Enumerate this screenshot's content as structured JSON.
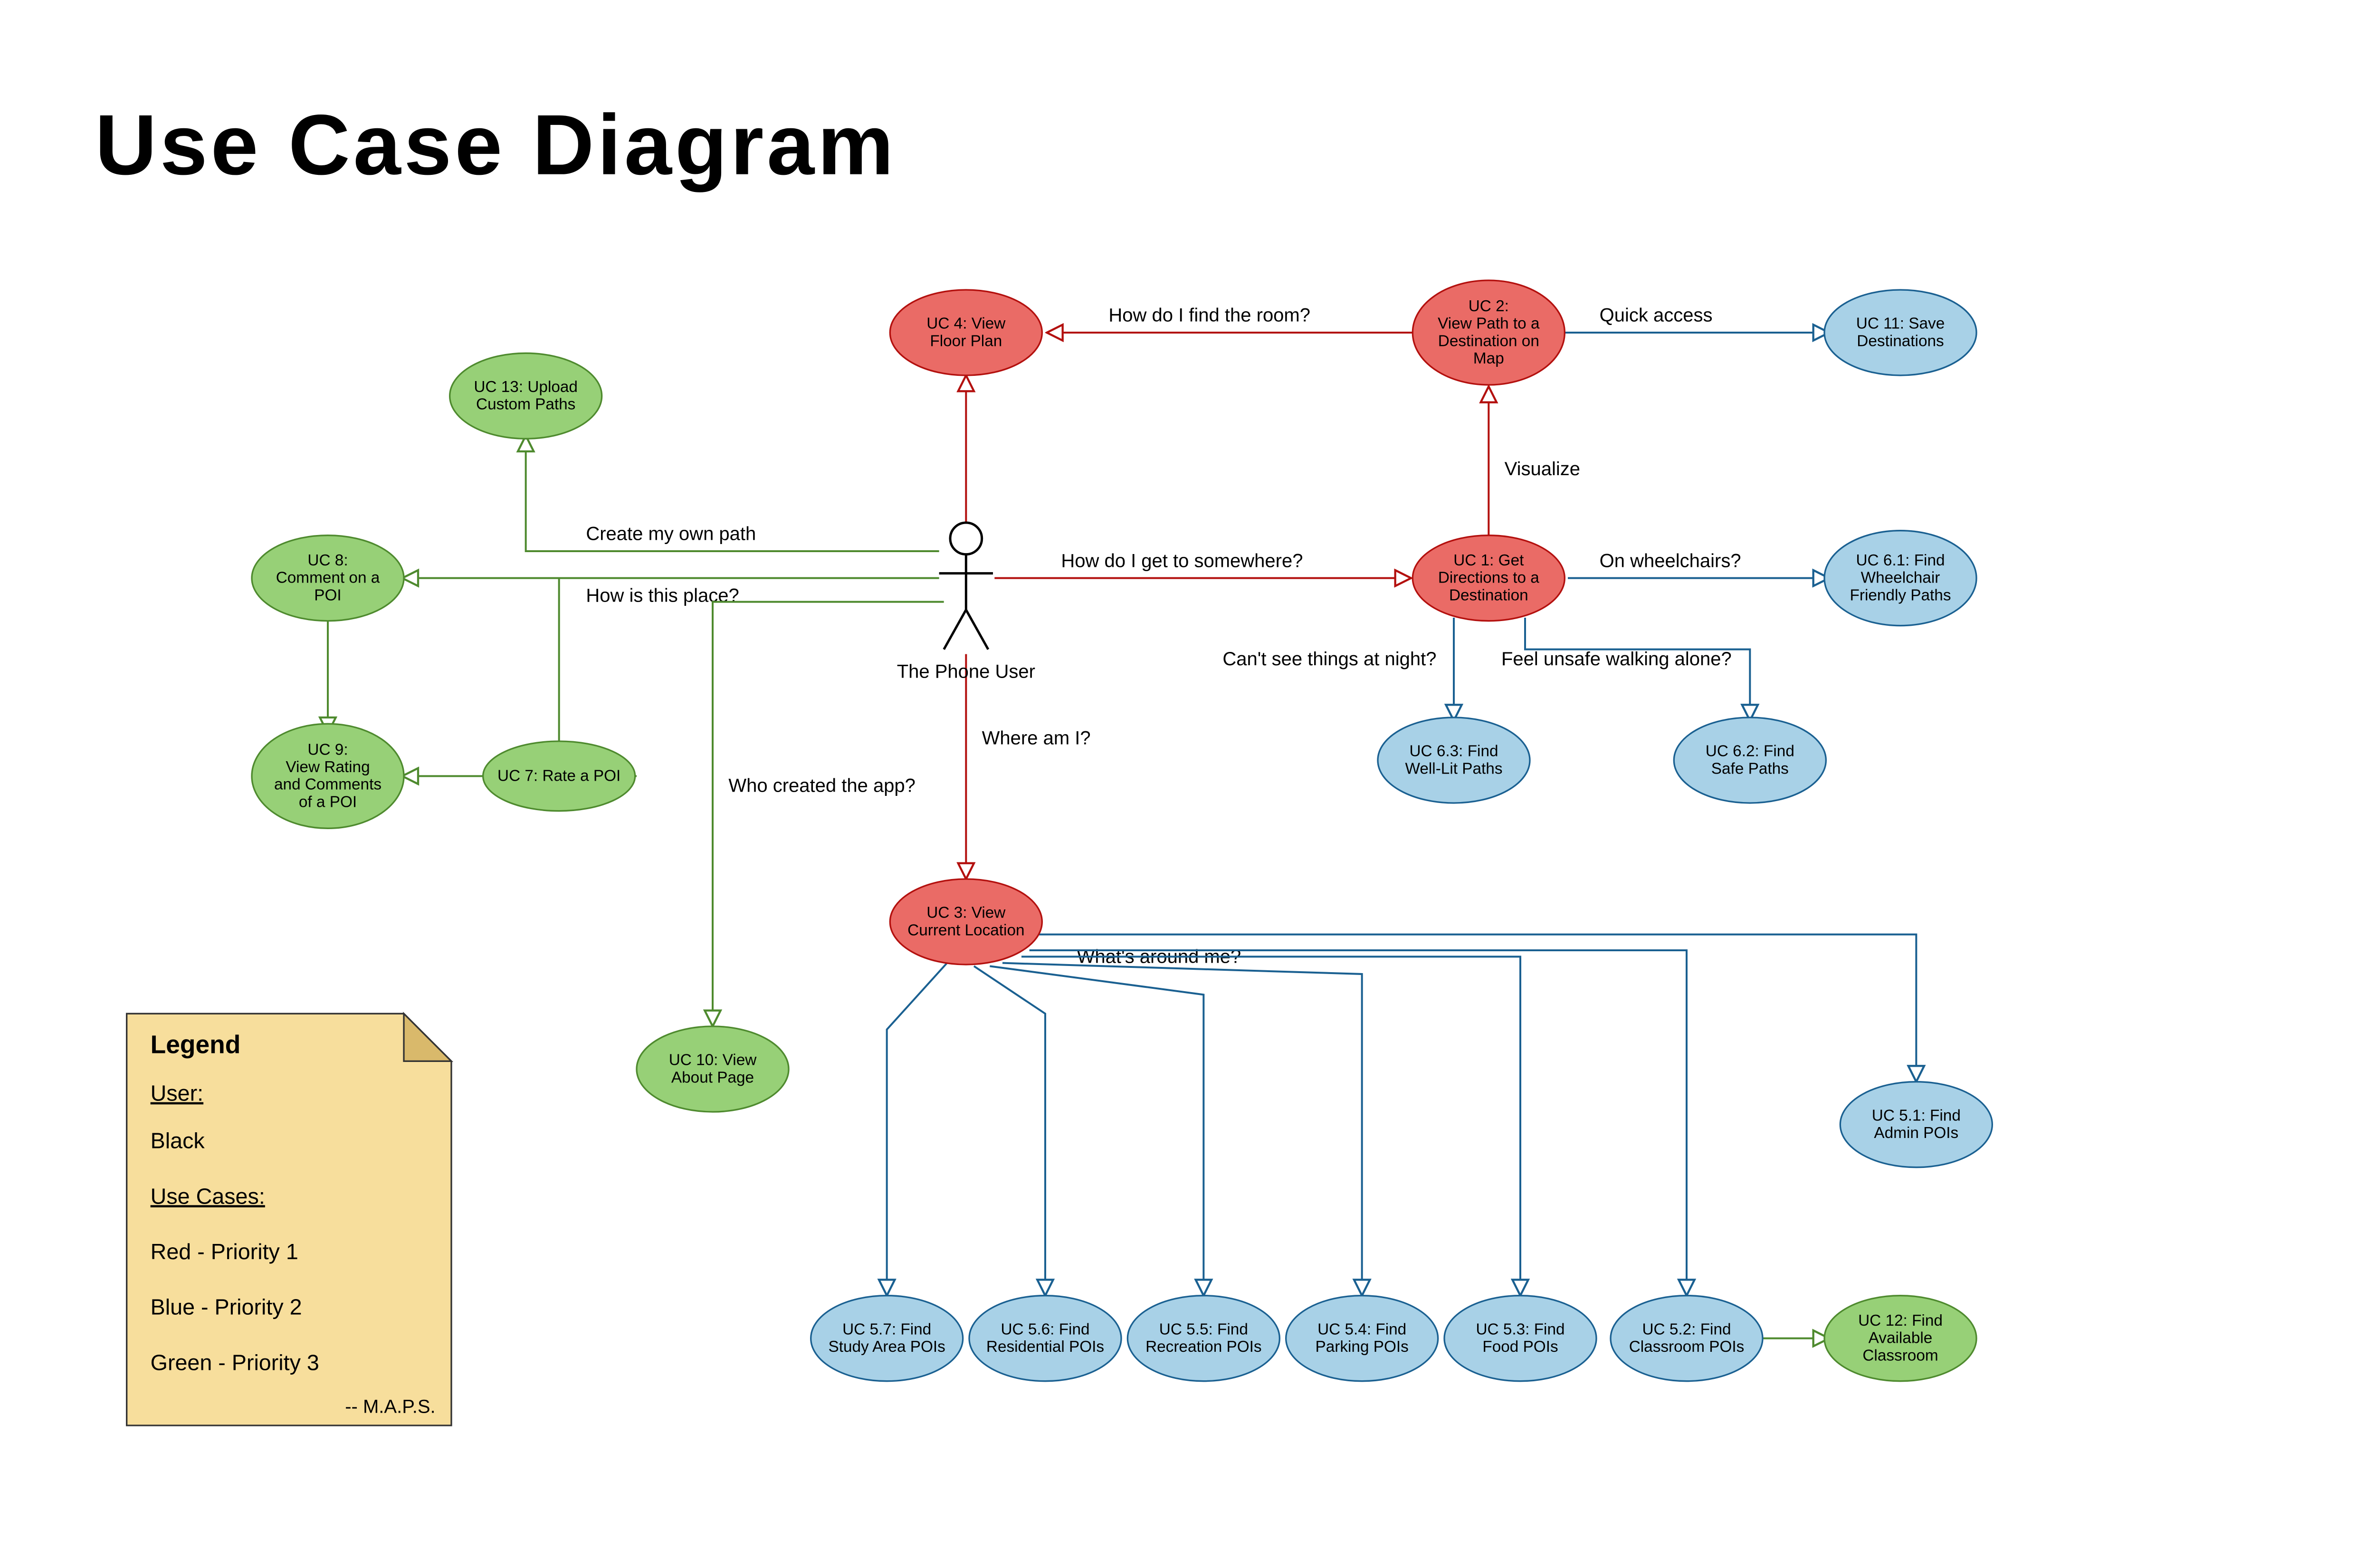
{
  "title": "Use Case Diagram",
  "actor": {
    "label": "The Phone User"
  },
  "nodes": {
    "uc4": {
      "label": "UC 4: View|Floor Plan"
    },
    "uc2": {
      "label": "UC 2:|View Path to a|Destination on|Map"
    },
    "uc11": {
      "label": "UC 11: Save|Destinations"
    },
    "uc13": {
      "label": "UC 13: Upload|Custom Paths"
    },
    "uc8": {
      "label": "UC 8:|Comment on a|POI"
    },
    "uc1": {
      "label": "UC 1: Get|Directions to a|Destination"
    },
    "uc61": {
      "label": "UC 6.1: Find|Wheelchair|Friendly Paths"
    },
    "uc7": {
      "label": "UC 7: Rate a POI"
    },
    "uc9": {
      "label": "UC 9:|View Rating|and Comments|of a POI"
    },
    "uc63": {
      "label": "UC 6.3: Find|Well-Lit Paths"
    },
    "uc62": {
      "label": "UC 6.2: Find|Safe Paths"
    },
    "uc3": {
      "label": "UC 3: View|Current Location"
    },
    "uc10": {
      "label": "UC 10: View|About Page"
    },
    "uc51": {
      "label": "UC 5.1: Find|Admin POIs"
    },
    "uc57": {
      "label": "UC 5.7: Find|Study Area POIs"
    },
    "uc56": {
      "label": "UC 5.6: Find|Residential POIs"
    },
    "uc55": {
      "label": "UC 5.5: Find|Recreation POIs"
    },
    "uc54": {
      "label": "UC 5.4: Find|Parking POIs"
    },
    "uc53": {
      "label": "UC 5.3: Find|Food POIs"
    },
    "uc52": {
      "label": "UC 5.2: Find|Classroom POIs"
    },
    "uc12": {
      "label": "UC 12: Find|Available|Classroom"
    }
  },
  "edgeLabels": {
    "findRoom": "How do I find the room?",
    "quickAccess": "Quick access",
    "visualize": "Visualize",
    "ownPath": "Create my own path",
    "getSomewhere": "How do I get to somewhere?",
    "wheelchairs": "On wheelchairs?",
    "howPlace": "How is this place?",
    "nightSee": "Can't see things at night?",
    "unsafe": "Feel unsafe walking alone?",
    "whereAmI": "Where am I?",
    "whoCreated": "Who created the app?",
    "aroundMe": "What's around me?"
  },
  "legend": {
    "title": "Legend",
    "userHeading": "User:",
    "userColor": "Black",
    "ucHeading": "Use Cases:",
    "p1": "Red - Priority 1",
    "p2": "Blue - Priority 2",
    "p3": "Green - Priority 3",
    "signature": "-- M.A.P.S."
  },
  "colors": {
    "red": "#EA6B66",
    "redStroke": "#B3100E",
    "blue": "#A8D1E7",
    "blueStroke": "#1A6091",
    "green": "#97D077",
    "greenStroke": "#4E8A2E",
    "note": "#F7DE9C",
    "noteStroke": "#333333",
    "noteFold": "#D9B96B"
  }
}
